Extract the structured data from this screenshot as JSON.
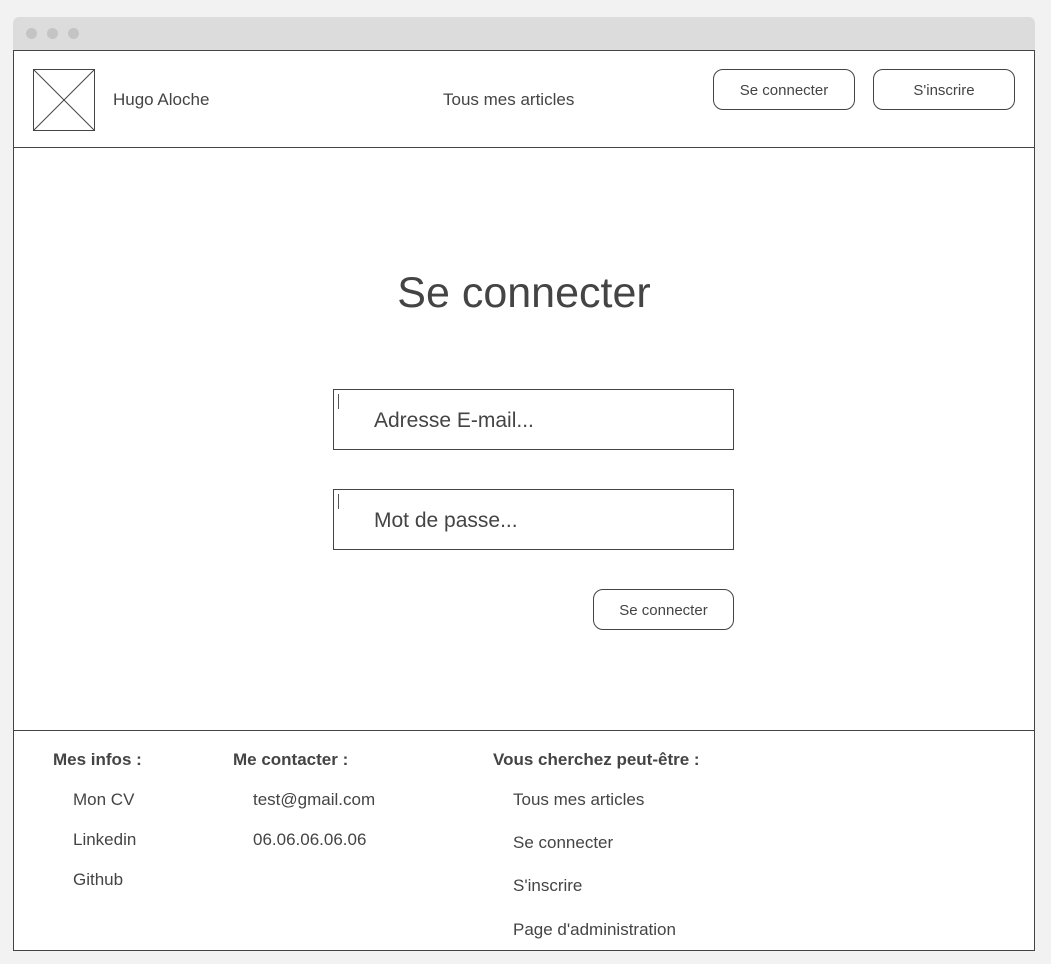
{
  "header": {
    "site_name": "Hugo Aloche",
    "nav_articles": "Tous mes articles",
    "login_label": "Se connecter",
    "signup_label": "S'inscrire"
  },
  "main": {
    "title": "Se connecter",
    "email_placeholder": "Adresse E-mail...",
    "password_placeholder": "Mot de passe...",
    "submit_label": "Se connecter"
  },
  "footer": {
    "infos": {
      "title": "Mes infos :",
      "items": [
        "Mon CV",
        "Linkedin",
        "Github"
      ]
    },
    "contact": {
      "title": "Me contacter :",
      "items": [
        "test@gmail.com",
        "06.06.06.06.06"
      ]
    },
    "suggestions": {
      "title": "Vous cherchez peut-être :",
      "items": [
        "Tous mes articles",
        "Se connecter",
        "S'inscrire",
        "Page d'administration"
      ]
    }
  }
}
